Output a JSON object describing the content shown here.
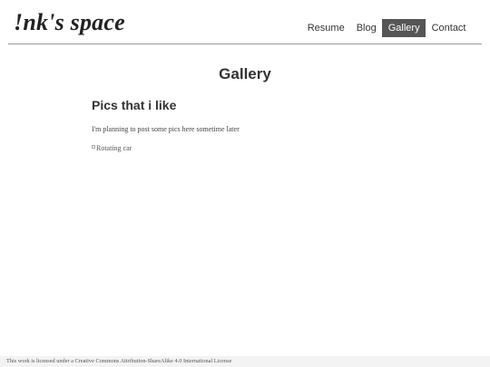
{
  "header": {
    "logo": "!nk's space",
    "nav": [
      {
        "label": "Resume",
        "active": false
      },
      {
        "label": "Blog",
        "active": false
      },
      {
        "label": "Gallery",
        "active": true
      },
      {
        "label": "Contact",
        "active": false
      }
    ]
  },
  "main": {
    "title": "Gallery",
    "section_title": "Pics that i like",
    "section_text": "I'm planning to post some pics here sometime later",
    "image_alt": "Rotating car"
  },
  "footer": {
    "license_text": "This work is licensed under a Creative Commons Attribution-ShareAlike 4.0 International License"
  },
  "colors": {
    "active_nav_bg": "#555555",
    "active_nav_text": "#ffffff",
    "footer_bg": "#f3f3f3"
  }
}
